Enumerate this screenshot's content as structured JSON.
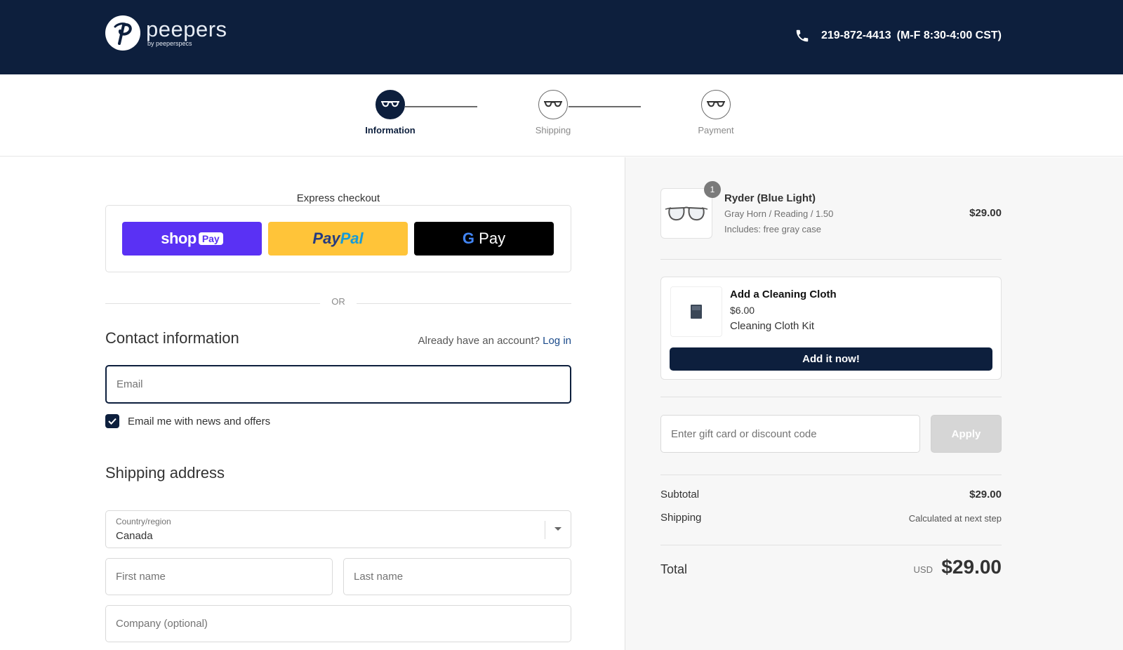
{
  "header": {
    "brand": "peepers",
    "brand_sub": "by peeperspecs",
    "phone": "219-872-4413",
    "hours": "(M-F 8:30-4:00 CST)",
    "bg_color": "#0d1f3d"
  },
  "steps": [
    {
      "label": "Information",
      "active": true
    },
    {
      "label": "Shipping",
      "active": false
    },
    {
      "label": "Payment",
      "active": false
    }
  ],
  "express": {
    "title": "Express checkout",
    "shop_pay": {
      "word": "shop",
      "badge": "Pay",
      "color": "#5a31f4"
    },
    "paypal": {
      "part1": "Pay",
      "part2": "Pal",
      "color": "#ffc439"
    },
    "gpay": {
      "g": "G",
      "word": "Pay",
      "color": "#000000"
    },
    "or_text": "OR"
  },
  "contact": {
    "title": "Contact information",
    "account_prompt": "Already have an account?",
    "login_link": "Log in",
    "email_placeholder": "Email",
    "email_value": "",
    "newsletter_label": "Email me with news and offers",
    "newsletter_checked": true
  },
  "shipping": {
    "title": "Shipping address",
    "country_label": "Country/region",
    "country_value": "Canada",
    "first_name_placeholder": "First name",
    "last_name_placeholder": "Last name",
    "company_placeholder": "Company (optional)"
  },
  "cart": {
    "item": {
      "quantity": "1",
      "name": "Ryder (Blue Light)",
      "variant": "Gray Horn / Reading / 1.50",
      "includes": "Includes: free gray case",
      "price": "$29.00"
    },
    "upsell": {
      "title": "Add a Cleaning Cloth",
      "price": "$6.00",
      "description": "Cleaning Cloth Kit",
      "button": "Add it now!"
    },
    "discount": {
      "placeholder": "Enter gift card or discount code",
      "button": "Apply"
    },
    "summary": {
      "subtotal_label": "Subtotal",
      "subtotal_value": "$29.00",
      "shipping_label": "Shipping",
      "shipping_value": "Calculated at next step",
      "total_label": "Total",
      "currency": "USD",
      "total_value": "$29.00"
    }
  }
}
